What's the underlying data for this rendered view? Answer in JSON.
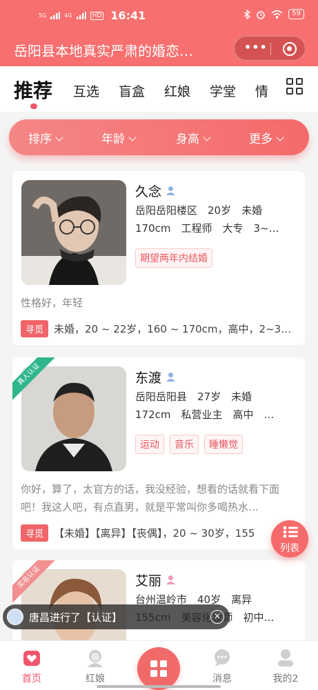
{
  "status_bar": {
    "signal1": "5G",
    "signal2": "4G",
    "hd": "HD",
    "time": "16:41",
    "battery": "59"
  },
  "app": {
    "title": "岳阳县本地真实严肃的婚恋…",
    "more": "•••"
  },
  "tabs": [
    {
      "label": "推荐"
    },
    {
      "label": "互选"
    },
    {
      "label": "盲盒"
    },
    {
      "label": "红娘"
    },
    {
      "label": "学堂"
    },
    {
      "label": "情"
    }
  ],
  "filters": [
    {
      "label": "排序"
    },
    {
      "label": "年龄"
    },
    {
      "label": "身高"
    },
    {
      "label": "更多"
    }
  ],
  "profiles": [
    {
      "name": "久念",
      "ribbon": "",
      "gender": "male",
      "line1": "岳阳岳阳楼区　20岁　未婚",
      "line2": "170cm　工程师　大专　3~…",
      "tags": [
        "期望两年内结婚"
      ],
      "bio": "性格好，年轻",
      "seek_badge": "寻觅",
      "seek": "未婚，20 ~ 22岁，160 ~ 170cm，高中，2~3…"
    },
    {
      "name": "东渡",
      "ribbon": "真人认证",
      "gender": "male",
      "line1": "岳阳岳阳县　27岁　未婚",
      "line2": "172cm　私营业主　高中　…",
      "tags": [
        "运动",
        "音乐",
        "睡懒觉"
      ],
      "bio": "你好，算了，太官方的话，我没经验，想看的话就看下面吧！我这人吧，有点直男，就是平常叫你多喝热水…",
      "seek_badge": "寻觅",
      "seek": "【未婚】【离异】【丧偶】，20 ~ 30岁，155"
    },
    {
      "name": "艾丽",
      "ribbon": "实名认证",
      "gender": "female",
      "line1": "台州温岭市　40岁　离异",
      "line2": "155cm　美容化妆师　初中…",
      "tags": [],
      "bio": "",
      "seek_badge": "",
      "seek": ""
    }
  ],
  "list_fab": {
    "label": "列表"
  },
  "toast": {
    "text": "唐昌进行了【认证】"
  },
  "tabbar": [
    {
      "label": "首页"
    },
    {
      "label": "红娘"
    },
    {
      "label": ""
    },
    {
      "label": "消息"
    },
    {
      "label": "我的2"
    }
  ],
  "colors": {
    "brand": "#f76f6f",
    "accent": "#f0566a",
    "verified": "#2fb58c"
  }
}
